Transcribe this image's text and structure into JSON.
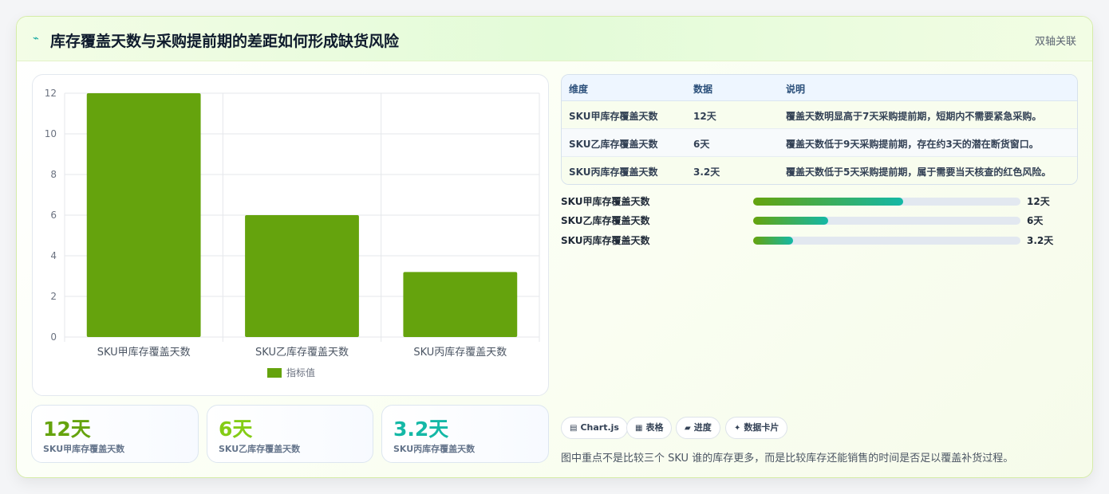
{
  "header": {
    "icon": "lightning-icon",
    "icon_glyph": "⌁",
    "title": "库存覆盖天数与采购提前期的差距如何形成缺货风险",
    "tag": "双轴关联"
  },
  "chart_data": {
    "type": "bar",
    "categories": [
      "SKU甲库存覆盖天数",
      "SKU乙库存覆盖天数",
      "SKU丙库存覆盖天数"
    ],
    "series": [
      {
        "name": "指标值",
        "values": [
          12,
          6,
          3.2
        ],
        "color": "#65a30d"
      }
    ],
    "y_ticks": [
      0,
      2,
      4,
      6,
      8,
      10,
      12
    ],
    "ylim": [
      0,
      12
    ],
    "grid": true,
    "legend": "bottom"
  },
  "stats": [
    {
      "value": "12天",
      "label": "SKU甲库存覆盖天数",
      "color": "#65a30d"
    },
    {
      "value": "6天",
      "label": "SKU乙库存覆盖天数",
      "color": "#84cc16"
    },
    {
      "value": "3.2天",
      "label": "SKU丙库存覆盖天数",
      "color": "#14b8a6"
    }
  ],
  "table": {
    "headers": [
      "维度",
      "数据",
      "说明"
    ],
    "rows": [
      [
        "SKU甲库存覆盖天数",
        "12天",
        "覆盖天数明显高于7天采购提前期，短期内不需要紧急采购。"
      ],
      [
        "SKU乙库存覆盖天数",
        "6天",
        "覆盖天数低于9天采购提前期，存在约3天的潜在断货窗口。"
      ],
      [
        "SKU丙库存覆盖天数",
        "3.2天",
        "覆盖天数低于5天采购提前期，属于需要当天核查的红色风险。"
      ]
    ]
  },
  "progress": [
    {
      "label": "SKU甲库存覆盖天数",
      "value_text": "12天",
      "fraction": 0.56
    },
    {
      "label": "SKU乙库存覆盖天数",
      "value_text": "6天",
      "fraction": 0.28
    },
    {
      "label": "SKU丙库存覆盖天数",
      "value_text": "3.2天",
      "fraction": 0.15
    }
  ],
  "chips": [
    {
      "icon": "chart-icon",
      "glyph": "▤",
      "label": "Chart.js"
    },
    {
      "icon": "table-icon",
      "glyph": "▦",
      "label": "表格"
    },
    {
      "icon": "progress-icon",
      "glyph": "▰",
      "label": "进度"
    },
    {
      "icon": "sparkle-icon",
      "glyph": "✦",
      "label": "数据卡片"
    }
  ],
  "footnote": "图中重点不是比较三个 SKU 谁的库存更多，而是比较库存还能销售的时间是否足以覆盖补货过程。",
  "colors": {
    "accent_green": "#65a30d",
    "accent_teal": "#14b8a6",
    "border": "#d5eca8"
  }
}
